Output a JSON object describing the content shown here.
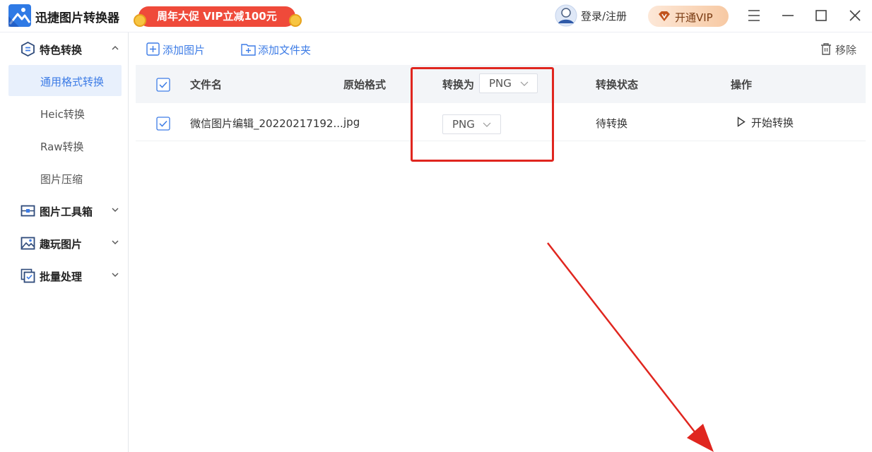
{
  "app": {
    "title": "迅捷图片转换器",
    "promo": "周年大促 VIP立减100元",
    "login": "登录/注册",
    "vip": "开通VIP"
  },
  "sidebar": {
    "sections": [
      {
        "label": "特色转换",
        "icon": "convert-icon",
        "expanded": true
      },
      {
        "label": "图片工具箱",
        "icon": "toolbox-icon",
        "expanded": false
      },
      {
        "label": "趣玩图片",
        "icon": "fun-image-icon",
        "expanded": false
      },
      {
        "label": "批量处理",
        "icon": "batch-icon",
        "expanded": false
      }
    ],
    "items": [
      {
        "label": "通用格式转换",
        "active": true
      },
      {
        "label": "Heic转换"
      },
      {
        "label": "Raw转换"
      },
      {
        "label": "图片压缩"
      }
    ]
  },
  "toolbar": {
    "add_image": "添加图片",
    "add_folder": "添加文件夹",
    "remove": "移除"
  },
  "table": {
    "columns": {
      "filename": "文件名",
      "orig_format": "原始格式",
      "convert_to": "转换为",
      "status": "转换状态",
      "action": "操作"
    },
    "header_format": "PNG",
    "rows": [
      {
        "filename": "微信图片编辑_20220217192...",
        "format": "jpg",
        "target": "PNG",
        "status": "待转换",
        "action": "开始转换"
      }
    ]
  },
  "colors": {
    "accent": "#3d7ce6",
    "highlight": "#e0261f",
    "promo": "#ef4a3a"
  }
}
